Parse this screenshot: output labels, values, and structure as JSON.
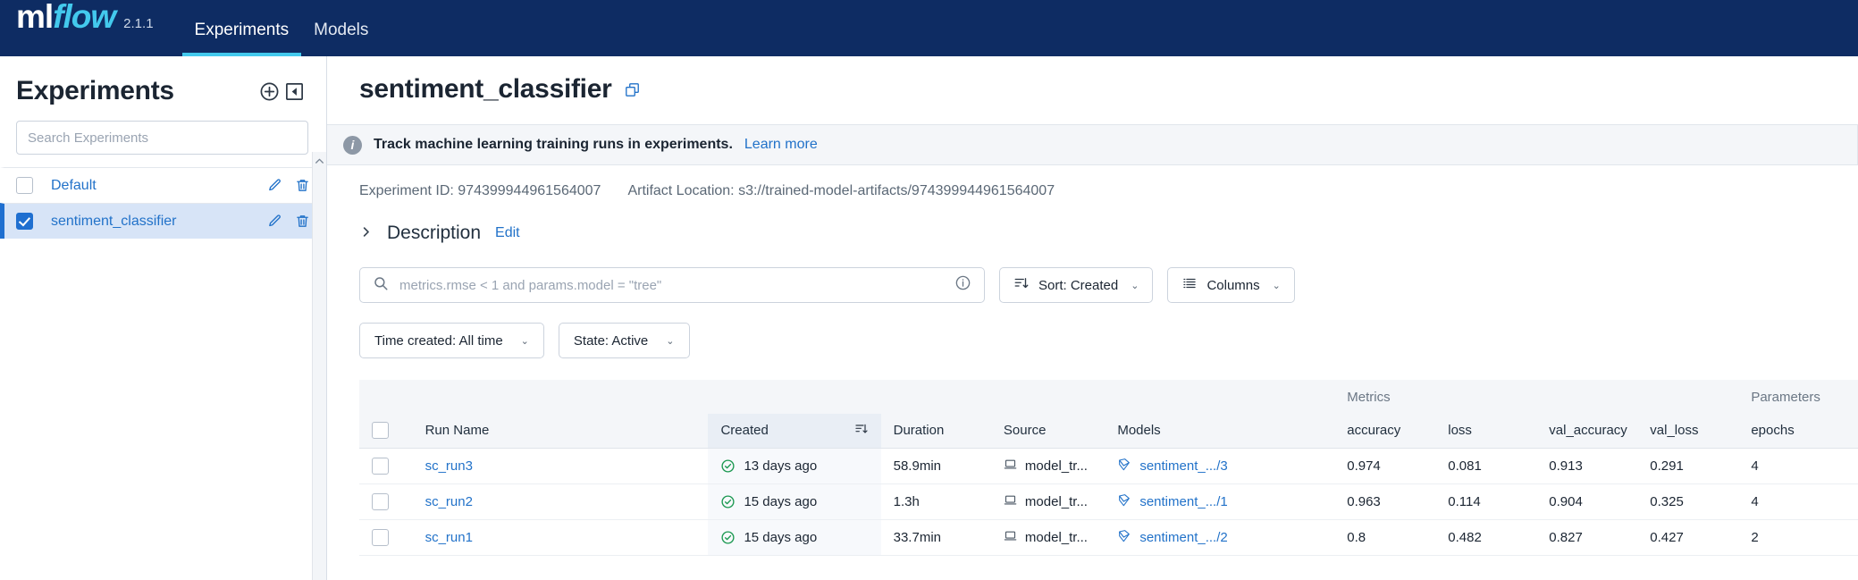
{
  "colors": {
    "navbar": "#0e2c63",
    "accent": "#43c9ed",
    "link": "#2272c9",
    "selected_row": "#d7e4f7",
    "success": "#1a9850"
  },
  "topnav": {
    "logo_ml": "ml",
    "logo_flow": "flow",
    "version": "2.1.1",
    "tabs": [
      {
        "label": "Experiments",
        "active": true
      },
      {
        "label": "Models",
        "active": false
      }
    ]
  },
  "sidebar": {
    "title": "Experiments",
    "new_experiment_icon": "plus-circle-icon",
    "collapse_icon": "collapse-sidebar-icon",
    "search": {
      "placeholder": "Search Experiments",
      "value": ""
    },
    "items": [
      {
        "label": "Default",
        "checked": false,
        "selected": false
      },
      {
        "label": "sentiment_classifier",
        "checked": true,
        "selected": true
      }
    ],
    "row_icons": {
      "edit": "pencil-icon",
      "delete": "trash-icon"
    }
  },
  "main": {
    "title": "sentiment_classifier",
    "copy_icon": "copy-icon",
    "banner": {
      "icon": "info-icon",
      "text": "Track machine learning training runs in experiments.",
      "link": "Learn more"
    },
    "meta": {
      "experiment_id_label": "Experiment ID:",
      "experiment_id": "974399944961564007",
      "artifact_label": "Artifact Location:",
      "artifact_location": "s3://trained-model-artifacts/974399944961564007"
    },
    "description": {
      "chevron_icon": "chevron-right-icon",
      "title": "Description",
      "edit_label": "Edit"
    },
    "toolbar": {
      "search_icon": "search-icon",
      "search_placeholder": "metrics.rmse < 1 and params.model = \"tree\"",
      "search_value": "",
      "search_info_icon": "info-circle-icon",
      "sort_icon": "sort-descending-icon",
      "sort_label": "Sort: Created",
      "columns_icon": "columns-list-icon",
      "columns_label": "Columns",
      "caret": "⌄"
    },
    "filters": [
      {
        "label": "Time created: All time"
      },
      {
        "label": "State: Active"
      }
    ]
  },
  "table": {
    "groups": {
      "metrics": "Metrics",
      "parameters": "Parameters"
    },
    "headers": {
      "run_name": "Run Name",
      "created": "Created",
      "duration": "Duration",
      "source": "Source",
      "models": "Models",
      "accuracy": "accuracy",
      "loss": "loss",
      "val_accuracy": "val_accuracy",
      "val_loss": "val_loss",
      "epochs": "epochs"
    },
    "sort_icon": "sort-descending-icon",
    "rows": [
      {
        "checked": false,
        "run_name": "sc_run3",
        "status_icon": "check-circle-icon",
        "created": "13 days ago",
        "duration": "58.9min",
        "source_icon": "laptop-icon",
        "source": "model_tr...",
        "model_icon": "mlflow-model-icon",
        "model": "sentiment_.../3",
        "accuracy": "0.974",
        "loss": "0.081",
        "val_accuracy": "0.913",
        "val_loss": "0.291",
        "epochs": "4"
      },
      {
        "checked": false,
        "run_name": "sc_run2",
        "status_icon": "check-circle-icon",
        "created": "15 days ago",
        "duration": "1.3h",
        "source_icon": "laptop-icon",
        "source": "model_tr...",
        "model_icon": "mlflow-model-icon",
        "model": "sentiment_.../1",
        "accuracy": "0.963",
        "loss": "0.114",
        "val_accuracy": "0.904",
        "val_loss": "0.325",
        "epochs": "4"
      },
      {
        "checked": false,
        "run_name": "sc_run1",
        "status_icon": "check-circle-icon",
        "created": "15 days ago",
        "duration": "33.7min",
        "source_icon": "laptop-icon",
        "source": "model_tr...",
        "model_icon": "mlflow-model-icon",
        "model": "sentiment_.../2",
        "accuracy": "0.8",
        "loss": "0.482",
        "val_accuracy": "0.827",
        "val_loss": "0.427",
        "epochs": "2"
      }
    ]
  }
}
